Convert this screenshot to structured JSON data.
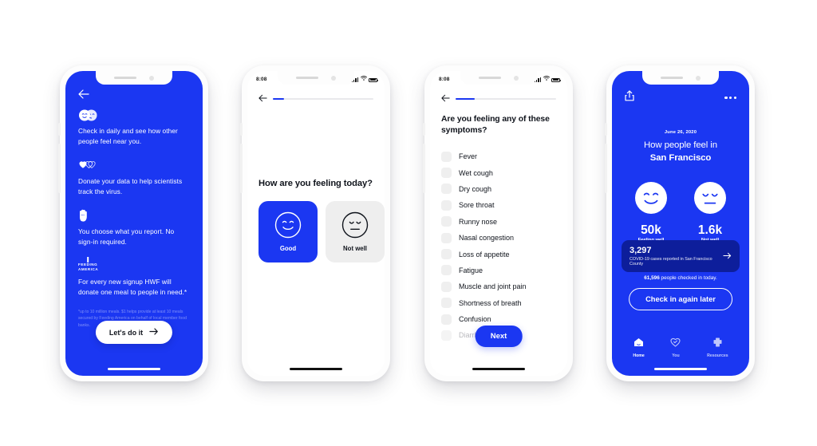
{
  "colors": {
    "brand_blue": "#1B37F2",
    "deep_blue": "#0D1E9B",
    "dark_text": "#10141c",
    "light_gray": "#efefef"
  },
  "phone1": {
    "status": {
      "time": ""
    },
    "back_icon": "back-arrow-icon",
    "features": [
      {
        "icon": "two-faces-icon",
        "text": "Check in daily and see how other people feel near you."
      },
      {
        "icon": "hearts-icon",
        "text": "Donate your data to help scientists track the virus."
      },
      {
        "icon": "raised-hand-icon",
        "text": "You choose what you report. No sign-in required."
      },
      {
        "icon": "feeding-america-logo",
        "logo_line1": "FEEDING",
        "logo_line2": "AMERICA",
        "text": "For every new signup HWF will donate one meal to people in need.*"
      }
    ],
    "footnote": "*up to 10 million meals. $1 helps provide at least 10 meals secured by Feeding America on behalf of local member food banks.",
    "cta_label": "Let's do it",
    "cta_icon": "arrow-right-icon"
  },
  "phone2": {
    "status": {
      "time": "8:08",
      "signal": "signal-bars-icon",
      "wifi": "wifi-icon",
      "battery": "battery-icon"
    },
    "back_icon": "back-arrow-icon",
    "progress_label": "step 1 of 9",
    "title": "How are you feeling today?",
    "moods": [
      {
        "id": "good",
        "label": "Good",
        "icon": "smiling-face-icon",
        "selected": true
      },
      {
        "id": "not-well",
        "label": "Not well",
        "icon": "sad-face-icon",
        "selected": false
      }
    ]
  },
  "phone3": {
    "status": {
      "time": "8:08",
      "signal": "signal-bars-icon",
      "wifi": "wifi-icon",
      "battery": "battery-icon"
    },
    "back_icon": "back-arrow-icon",
    "title": "Are you feeling any of these symptoms?",
    "symptoms": [
      {
        "label": "Fever",
        "checked": false
      },
      {
        "label": "Wet cough",
        "checked": false
      },
      {
        "label": "Dry cough",
        "checked": false
      },
      {
        "label": "Sore throat",
        "checked": false
      },
      {
        "label": "Runny nose",
        "checked": false
      },
      {
        "label": "Nasal congestion",
        "checked": false
      },
      {
        "label": "Loss of appetite",
        "checked": false
      },
      {
        "label": "Fatigue",
        "checked": false
      },
      {
        "label": "Muscle and joint pain",
        "checked": false
      },
      {
        "label": "Shortness of breath",
        "checked": false
      },
      {
        "label": "Confusion",
        "checked": false
      },
      {
        "label": "Diarrhea",
        "checked": false
      }
    ],
    "next_label": "Next"
  },
  "phone4": {
    "share_icon": "share-icon",
    "more_icon": "more-options-icon",
    "date": "June 26, 2020",
    "headline_line1": "How people feel in",
    "headline_line2": "San Francisco",
    "stats": [
      {
        "icon": "smiling-face-icon",
        "value": "50k",
        "label": "Feeling well"
      },
      {
        "icon": "sad-face-icon",
        "value": "1.6k",
        "label": "Not well"
      }
    ],
    "case_card": {
      "number": "3,297",
      "description": "COVID-19 cases reported in San Francisco County",
      "arrow_icon": "arrow-right-icon"
    },
    "checked_in_count": "61,596",
    "checked_in_suffix": " people checked in today.",
    "cta_label": "Check in again later",
    "tabs": [
      {
        "label": "Home",
        "icon": "home-icon",
        "active": true
      },
      {
        "label": "You",
        "icon": "heart-check-icon",
        "active": false
      },
      {
        "label": "Resources",
        "icon": "medical-cross-icon",
        "active": false
      }
    ]
  }
}
